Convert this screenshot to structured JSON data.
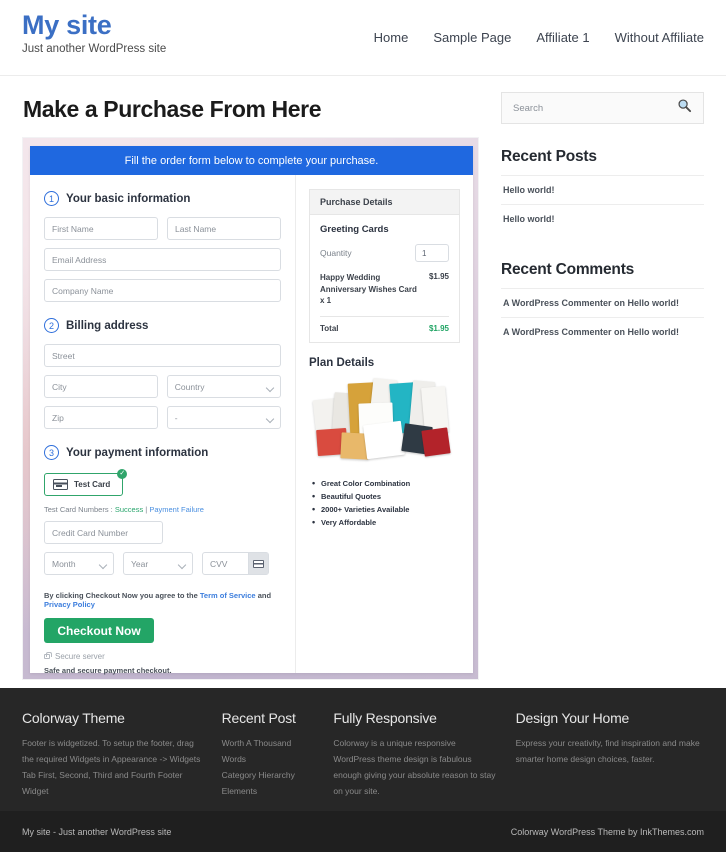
{
  "header": {
    "brand_title": "My site",
    "brand_tagline": "Just another WordPress site",
    "nav": [
      {
        "label": "Home"
      },
      {
        "label": "Sample Page"
      },
      {
        "label": "Affiliate 1"
      },
      {
        "label": "Without Affiliate"
      }
    ]
  },
  "main": {
    "page_title": "Make a Purchase From Here",
    "banner": "Fill the order form below to complete your purchase.",
    "steps": {
      "step1_num": "1",
      "step1_label": "Your basic information",
      "step2_num": "2",
      "step2_label": "Billing address",
      "step3_num": "3",
      "step3_label": "Your payment information"
    },
    "fields": {
      "first_name": "First Name",
      "last_name": "Last Name",
      "email": "Email Address",
      "company": "Company Name",
      "street": "Street",
      "city": "City",
      "country": "Country",
      "zip": "Zip",
      "state": "-",
      "card_number": "Credit Card Number",
      "month": "Month",
      "year": "Year",
      "cvv": "CVV"
    },
    "payment": {
      "test_card_label": "Test  Card",
      "test_card_check": "✓",
      "test_numbers_prefix": "Test Card Numbers : ",
      "test_numbers_success": "Success",
      "test_numbers_divider": " | ",
      "test_numbers_failure": "Payment Failure",
      "terms_prefix": "By clicking Checkout Now you agree to the ",
      "terms_tos": "Term of Service",
      "terms_and": " and ",
      "terms_privacy": "Privacy Policy",
      "checkout_label": "Checkout Now",
      "secure_server": "Secure server",
      "safe_note": "Safe and secure payment checkout."
    },
    "purchase_details": {
      "heading": "Purchase Details",
      "product": "Greeting Cards",
      "quantity_label": "Quantity",
      "quantity_value": "1",
      "item_name": "Happy Wedding Anniversary Wishes Card x 1",
      "item_price": "$1.95",
      "total_label": "Total",
      "total_value": "$1.95"
    },
    "plan": {
      "title": "Plan Details",
      "features": [
        "Great Color Combination",
        "Beautiful Quotes",
        "2000+ Varieties Available",
        "Very Affordable"
      ]
    }
  },
  "sidebar": {
    "search_placeholder": "Search",
    "recent_posts_title": "Recent Posts",
    "recent_posts": [
      {
        "label": "Hello world!"
      },
      {
        "label": "Hello world!"
      }
    ],
    "recent_comments_title": "Recent Comments",
    "recent_comments": [
      {
        "label": "A WordPress Commenter on Hello world!"
      },
      {
        "label": "A WordPress Commenter on Hello world!"
      }
    ]
  },
  "footer": {
    "columns": [
      {
        "title": "Colorway Theme",
        "text": "Footer is widgetized. To setup the footer, drag the required Widgets in Appearance -> Widgets Tab First, Second, Third and Fourth Footer Widget"
      },
      {
        "title": "Recent Post",
        "items": [
          {
            "label": "Worth A Thousand Words"
          },
          {
            "label": "Category Hierarchy"
          },
          {
            "label": "Elements"
          }
        ]
      },
      {
        "title": "Fully Responsive",
        "text": "Colorway is a unique responsive WordPress theme design is fabulous enough giving your absolute reason to stay on your site."
      },
      {
        "title": "Design Your Home",
        "text": "Express your creativity, find inspiration and make smarter home design choices, faster."
      }
    ],
    "copyright_left": "My site - Just another WordPress site",
    "copyright_right": "Colorway WordPress Theme by InkThemes.com"
  },
  "colors": {
    "brand_blue": "#3b6fc4",
    "banner_blue": "#1f68e0",
    "accent_green": "#23a566",
    "footer_dark": "#272727",
    "subfooter_dark": "#1f1f1f"
  }
}
